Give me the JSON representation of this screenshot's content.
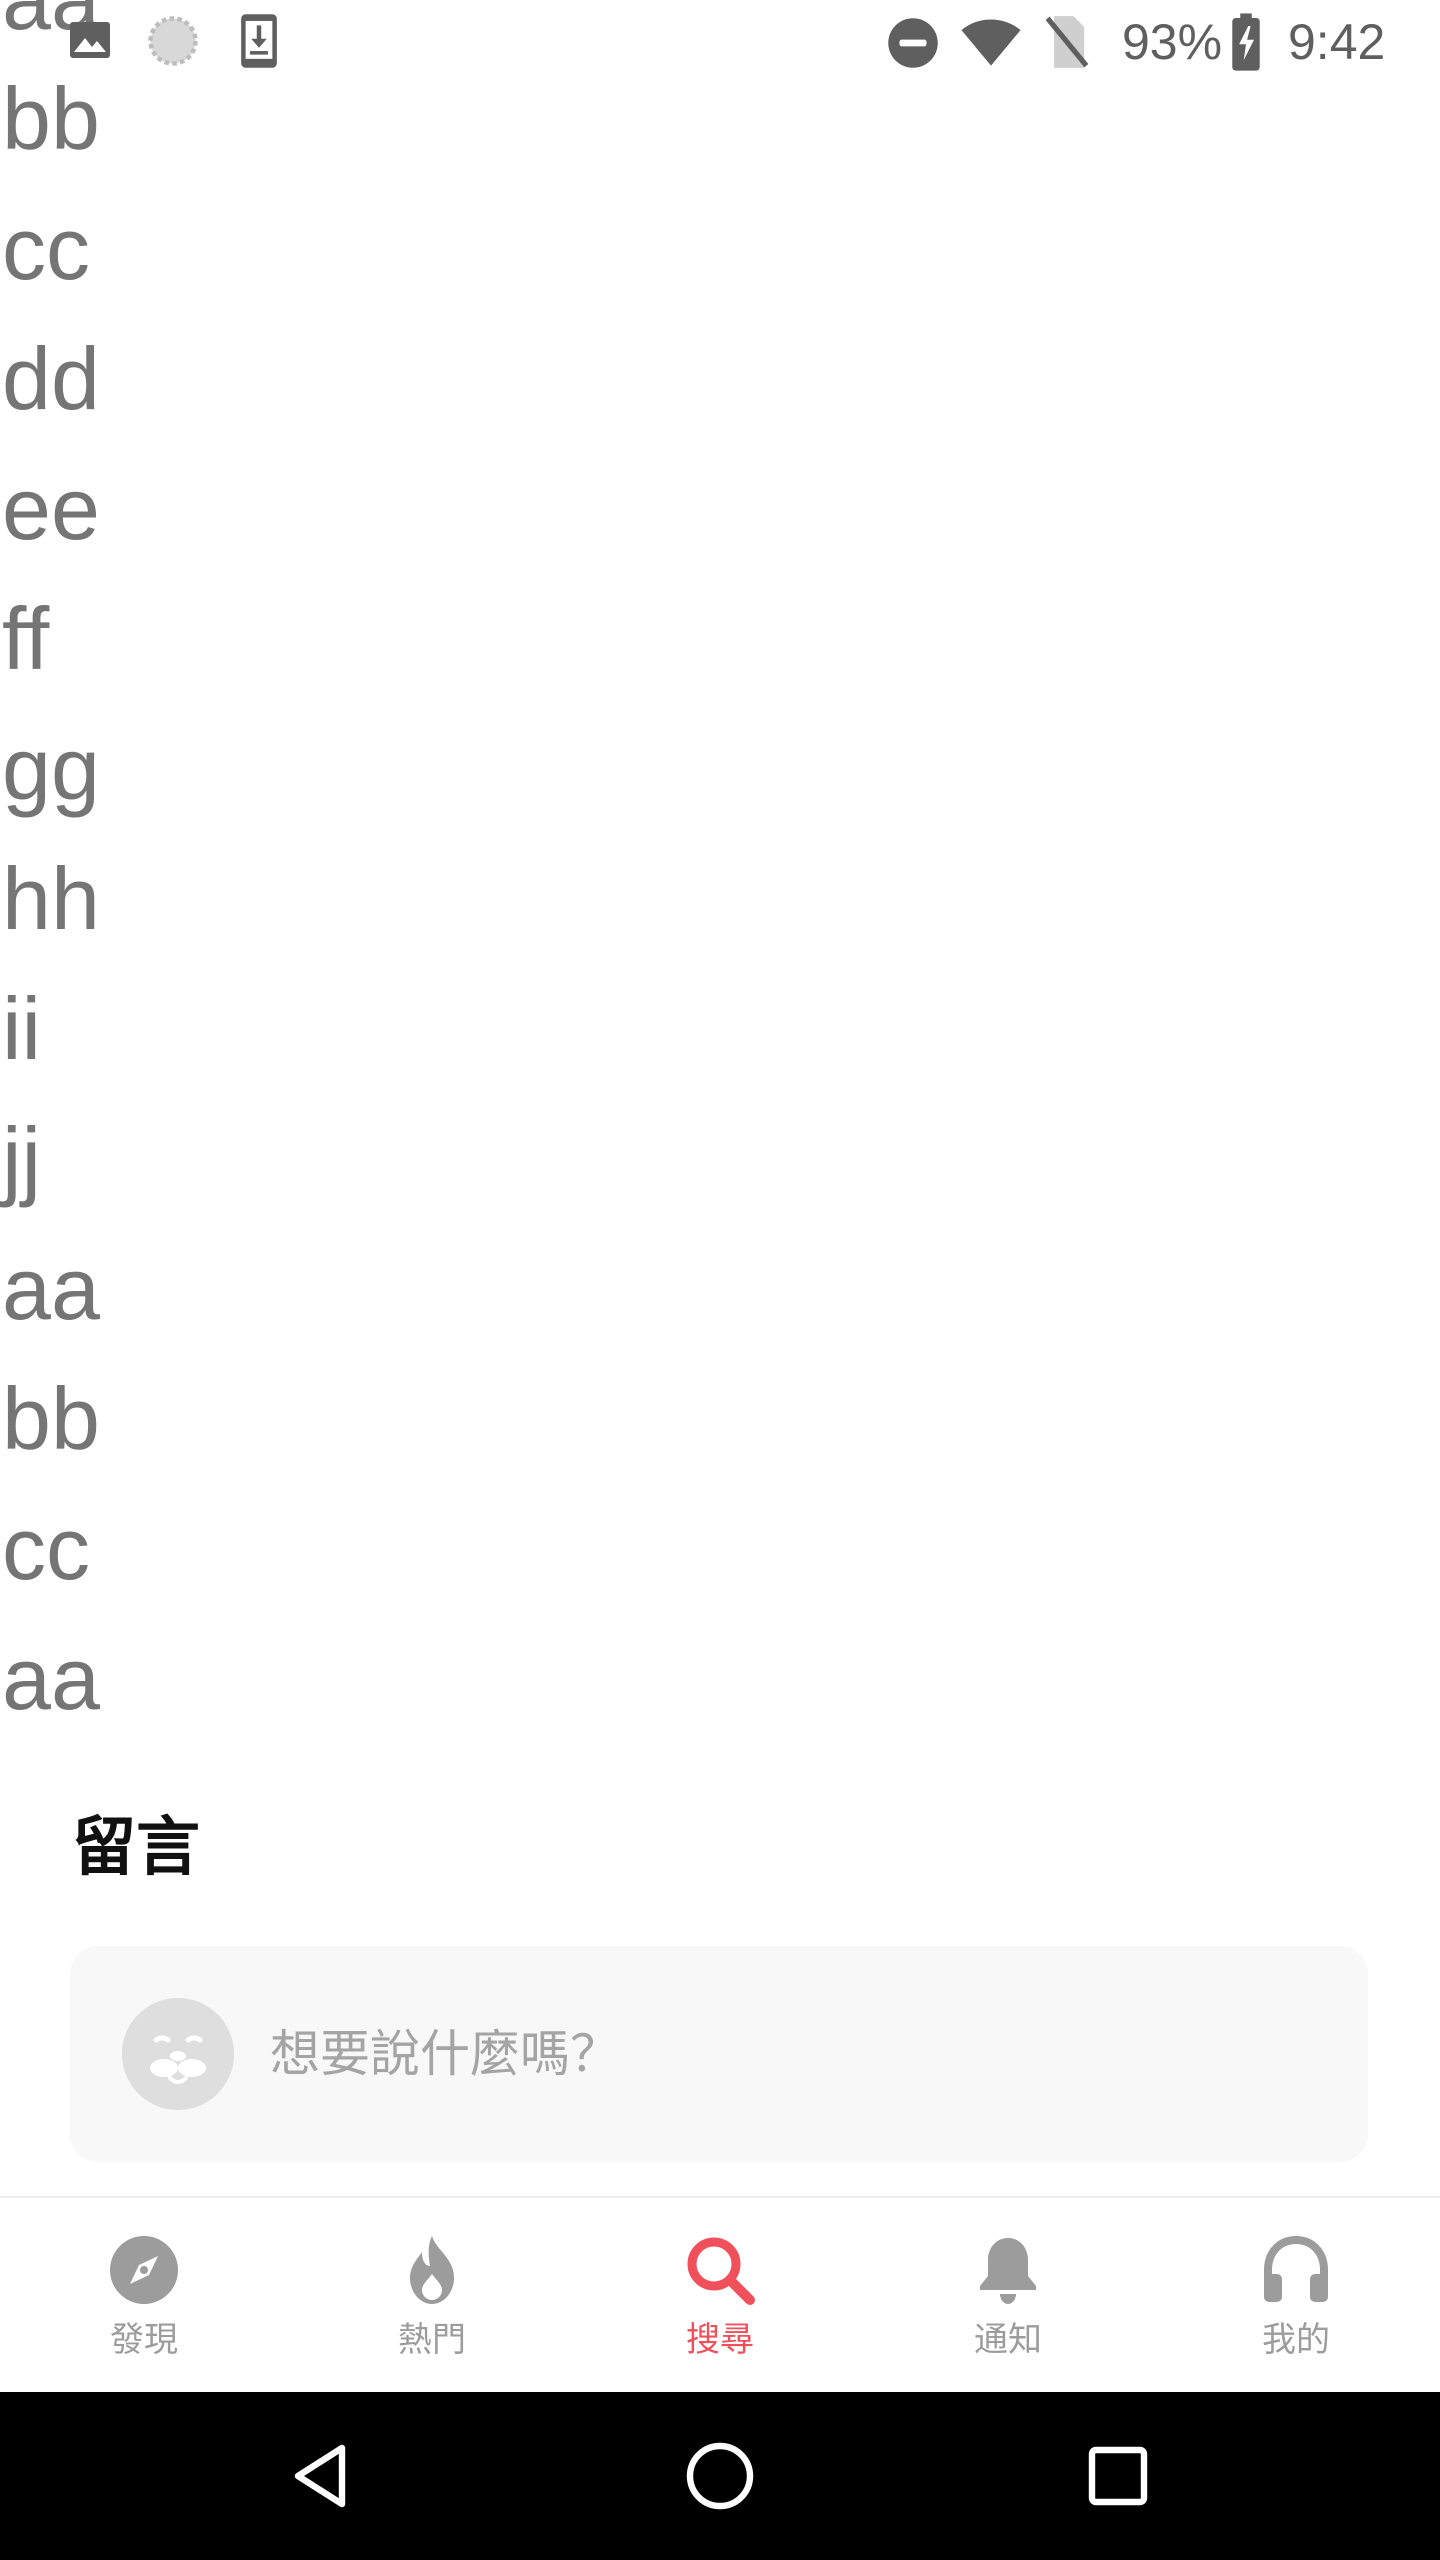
{
  "status_bar": {
    "battery": "93%",
    "time": "9:42",
    "left_icons": [
      "image-icon",
      "sync-icon",
      "download-icon"
    ],
    "right_icons": [
      "do-not-disturb-icon",
      "wifi-icon",
      "no-sim-icon",
      "battery-charging-icon"
    ]
  },
  "list": {
    "items": [
      "aa",
      "bb",
      "cc",
      "dd",
      "ee",
      "ff",
      "gg",
      "hh",
      "ii",
      "jj",
      "aa",
      "bb",
      "cc",
      "aa"
    ]
  },
  "comments": {
    "heading": "留言",
    "input_placeholder": "想要說什麼嗎？"
  },
  "bottom_nav": {
    "active_color": "#f0505a",
    "inactive_color": "#9c9c9c",
    "items": [
      {
        "label": "發現",
        "icon": "compass-icon"
      },
      {
        "label": "熱門",
        "icon": "flame-icon"
      },
      {
        "label": "搜尋",
        "icon": "search-icon",
        "active": true
      },
      {
        "label": "通知",
        "icon": "bell-icon"
      },
      {
        "label": "我的",
        "icon": "headphones-icon"
      }
    ]
  },
  "system_nav": {
    "buttons": [
      "back-icon",
      "home-icon",
      "recents-icon"
    ]
  }
}
